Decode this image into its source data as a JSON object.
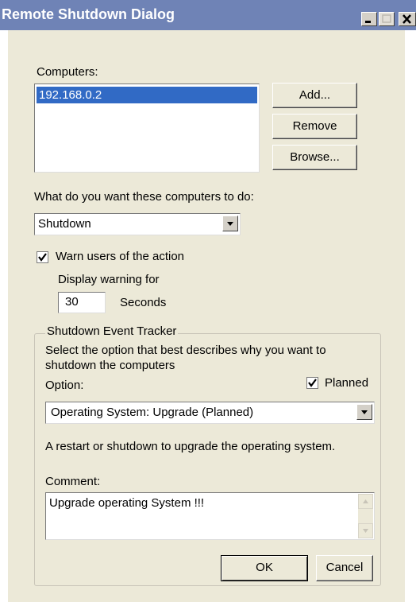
{
  "window": {
    "title": "Remote Shutdown Dialog",
    "controls": [
      "minimize-icon",
      "maximize-icon",
      "close-icon"
    ]
  },
  "computers": {
    "label": "Computers:",
    "items": [
      "192.168.0.2"
    ],
    "selected_index": 0,
    "add_label": "Add...",
    "remove_label": "Remove",
    "browse_label": "Browse..."
  },
  "action": {
    "label": "What do you want these computers to do:",
    "value": "Shutdown"
  },
  "warning": {
    "checkbox_label": "Warn users of the action",
    "checked": true,
    "display_label": "Display warning for",
    "seconds_value": "30",
    "seconds_unit": "Seconds"
  },
  "tracker": {
    "title": "Shutdown Event Tracker",
    "description": "Select the option that best describes why you want to shutdown the computers",
    "option_label": "Option:",
    "planned_label": "Planned",
    "planned_checked": true,
    "option_value": "Operating System: Upgrade (Planned)",
    "option_description": "A restart or shutdown to upgrade the operating system.",
    "comment_label": "Comment:",
    "comment_value": "Upgrade operating System !!!"
  },
  "footer": {
    "ok_label": "OK",
    "cancel_label": "Cancel"
  },
  "colors": {
    "titlebar": "#6f83b6",
    "selection": "#316ac5",
    "dialog_bg": "#ece9d8"
  }
}
